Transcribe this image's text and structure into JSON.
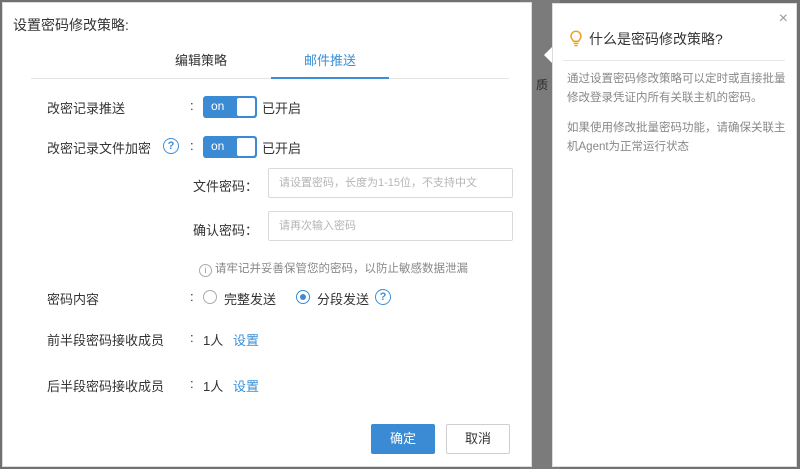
{
  "background": {
    "partial_text": "质"
  },
  "dialog": {
    "title": "设置密码修改策略:",
    "tabs": [
      {
        "label": "编辑策略",
        "active": false
      },
      {
        "label": "邮件推送",
        "active": true
      }
    ],
    "colon": ":",
    "push": {
      "label": "改密记录推送",
      "switch_text": "on",
      "state": "已开启"
    },
    "encrypt": {
      "label": "改密记录文件加密",
      "help": "?",
      "switch_text": "on",
      "state": "已开启"
    },
    "file_password": {
      "label": "文件密码：",
      "placeholder": "请设置密码，长度为1-15位，不支持中文"
    },
    "confirm_password": {
      "label": "确认密码：",
      "placeholder": "请再次输入密码"
    },
    "notice": {
      "icon": "i",
      "text": "请牢记并妥善保管您的密码，以防止敏感数据泄漏"
    },
    "content": {
      "label": "密码内容",
      "option_full": "完整发送",
      "option_split": "分段发送",
      "selected": "分段发送",
      "help": "?"
    },
    "first_half": {
      "label": "前半段密码接收成员",
      "count": "1人",
      "link": "设置"
    },
    "second_half": {
      "label": "后半段密码接收成员",
      "count": "1人",
      "link": "设置"
    },
    "buttons": {
      "ok": "确定",
      "cancel": "取消"
    },
    "accent_color": "#3a8ad4"
  },
  "help_panel": {
    "close": "×",
    "title": "什么是密码修改策略?",
    "p1": "通过设置密码修改策略可以定时或直接批量修改登录凭证内所有关联主机的密码。",
    "p2": "如果使用修改批量密码功能，请确保关联主机Agent为正常运行状态",
    "icon": "lightbulb-icon"
  }
}
